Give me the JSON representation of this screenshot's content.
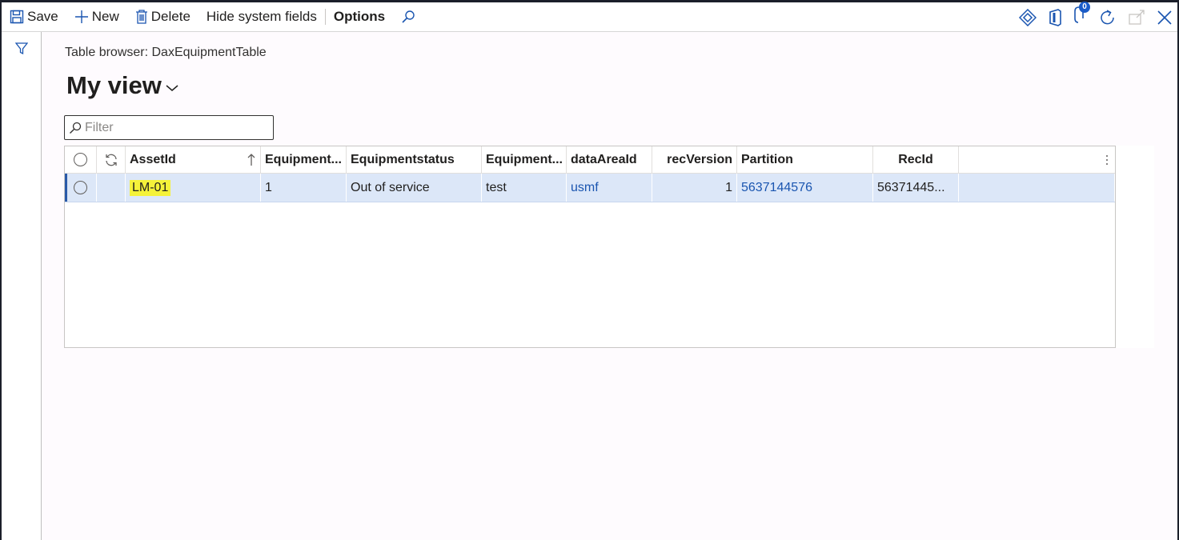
{
  "toolbar": {
    "save_label": "Save",
    "new_label": "New",
    "delete_label": "Delete",
    "hide_label": "Hide system fields",
    "options_label": "Options",
    "notification_count": "0"
  },
  "page": {
    "breadcrumb": "Table browser: DaxEquipmentTable",
    "view_title": "My view"
  },
  "filter": {
    "placeholder": "Filter"
  },
  "grid": {
    "columns": [
      "AssetId",
      "Equipment...",
      "Equipmentstatus",
      "Equipment...",
      "dataAreaId",
      "recVersion",
      "Partition",
      "RecId"
    ],
    "rows": [
      {
        "AssetId": "LM-01",
        "Equipment1": "1",
        "Equipmentstatus": "Out of service",
        "Equipment2": "test",
        "dataAreaId": "usmf",
        "recVersion": "1",
        "Partition": "5637144576",
        "RecId": "56371445..."
      }
    ]
  },
  "colors": {
    "accent": "#1a55b0",
    "selected_row": "#dce7f8",
    "highlight": "#f5f23a"
  }
}
